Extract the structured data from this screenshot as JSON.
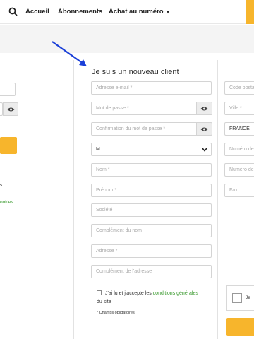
{
  "header": {
    "nav": [
      "Accueil",
      "Abonnements",
      "Achat au numéro"
    ],
    "dropdown_glyph": "▾"
  },
  "left_col": {
    "cookies_partial": "ookies",
    "s_partial": "s"
  },
  "form": {
    "title": "Je suis un nouveau client",
    "email_placeholder": "Adresse e-mail *",
    "password_placeholder": "Mot de passe *",
    "confirm_placeholder": "Confirmation du mot de passe *",
    "civility_value": "M",
    "lastname_placeholder": "Nom *",
    "firstname_placeholder": "Prénom *",
    "company_placeholder": "Société",
    "name_complement_placeholder": "Complément du nom",
    "address_placeholder": "Adresse *",
    "address_complement_placeholder": "Complément de l'adresse",
    "terms_prefix": "J'ai lu et j'accepte les",
    "terms_link": "conditions générales",
    "terms_suffix": "du site",
    "required_note": "* Champs obligatoires"
  },
  "right_col": {
    "postal_placeholder": "Code posta",
    "city_placeholder": "Ville *",
    "country_value": "FRANCE",
    "phone1_placeholder": "Numéro de",
    "phone2_placeholder": "Numéro de",
    "fax_placeholder": "Fax",
    "checkbox_text": "Je"
  },
  "colors": {
    "accent": "#f7b52c",
    "link_green": "#3a9a2e",
    "arrow_blue": "#1a3fd8"
  }
}
